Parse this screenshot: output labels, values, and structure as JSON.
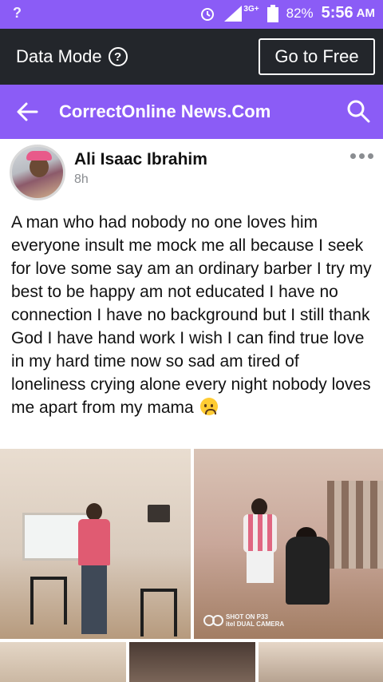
{
  "status_bar": {
    "left_indicator": "?",
    "network": "3G+",
    "battery": "82%",
    "time": "5:56",
    "ampm": "AM"
  },
  "data_bar": {
    "mode_label": "Data Mode",
    "help_glyph": "?",
    "cta_label": "Go to Free"
  },
  "app_bar": {
    "title": "CorrectOnline News.Com",
    "back_icon": "back-arrow-icon",
    "search_icon": "search-icon"
  },
  "post": {
    "author": "Ali Isaac Ibrahim",
    "time_ago": "8h",
    "text": "A man who had nobody no one loves  him everyone insult me mock me all because I seek for love some say am an ordinary barber I try my best to be happy am not educated I have no connection  I have no background but I still thank God I have hand work I wish I can find true love in my hard time now  so sad am tired of loneliness crying alone every night nobody loves me apart from my mama",
    "photo_watermark_line1": "SHOT ON P33",
    "photo_watermark_line2": "itel DUAL CAMERA"
  },
  "colors": {
    "brand_purple": "#8b5cf6",
    "dark_bar": "#23262b"
  }
}
